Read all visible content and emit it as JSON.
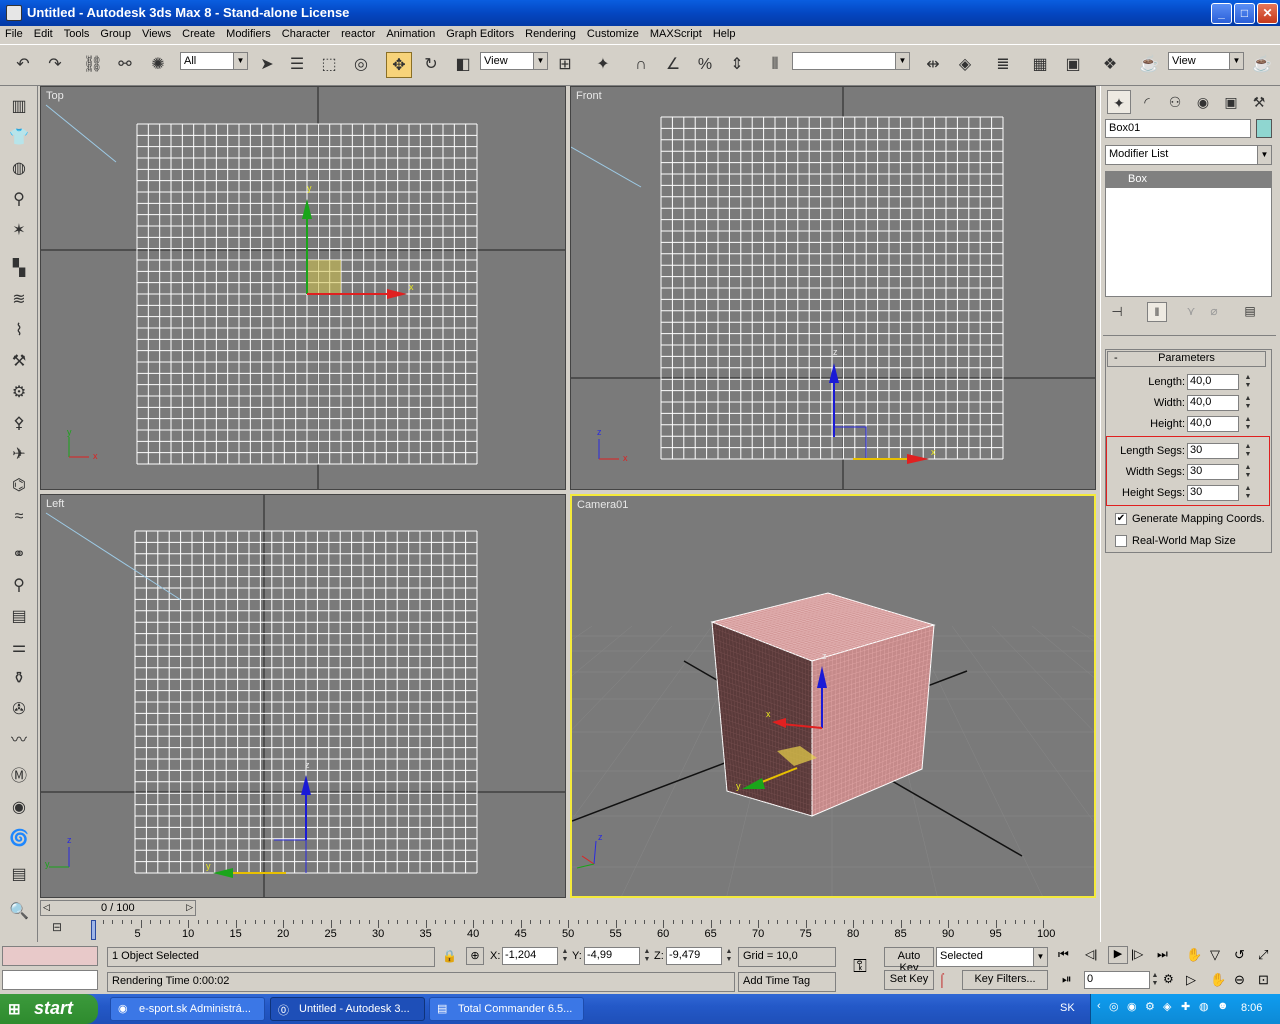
{
  "titlebar": {
    "title": "Untitled - Autodesk 3ds Max 8  - Stand-alone License",
    "min": "_",
    "max": "□",
    "close": "✕"
  },
  "menu": [
    "File",
    "Edit",
    "Tools",
    "Group",
    "Views",
    "Create",
    "Modifiers",
    "Character",
    "reactor",
    "Animation",
    "Graph Editors",
    "Rendering",
    "Customize",
    "MAXScript",
    "Help"
  ],
  "toolbar": {
    "selection_filter": "All",
    "ref_coord": "View",
    "named_sel": "",
    "render_view": "View"
  },
  "viewports": {
    "top": {
      "label": "Top"
    },
    "front": {
      "label": "Front"
    },
    "left": {
      "label": "Left"
    },
    "camera": {
      "label": "Camera01"
    }
  },
  "axes": {
    "x": "x",
    "y": "y",
    "z": "z"
  },
  "command_panel": {
    "object_name": "Box01",
    "modifier_list": "Modifier List",
    "stack_item": "Box",
    "rollout": {
      "collapse": "-",
      "title": "Parameters"
    },
    "params": [
      {
        "label": "Length:",
        "value": "40,0"
      },
      {
        "label": "Width:",
        "value": "40,0"
      },
      {
        "label": "Height:",
        "value": "40,0"
      },
      {
        "label": "Length Segs:",
        "value": "30"
      },
      {
        "label": "Width Segs:",
        "value": "30"
      },
      {
        "label": "Height Segs:",
        "value": "30"
      }
    ],
    "generate_mapping": {
      "label": "Generate Mapping Coords.",
      "checked": true
    },
    "real_world": {
      "label": "Real-World Map Size",
      "checked": false
    }
  },
  "timeline": {
    "frame": "0 / 100",
    "ticks": [
      "0",
      "5",
      "10",
      "15",
      "20",
      "25",
      "30",
      "35",
      "40",
      "45",
      "50",
      "55",
      "60",
      "65",
      "70",
      "75",
      "80",
      "85",
      "90",
      "95",
      "100"
    ]
  },
  "status": {
    "selected": "1 Object Selected",
    "prompt": "Rendering Time  0:00:02",
    "x": "-1,204",
    "y": "-4,99",
    "z": "-9,479",
    "x_label": "X:",
    "y_label": "Y:",
    "z_label": "Z:",
    "grid": "Grid = 10,0",
    "add_time_tag": "Add Time Tag",
    "auto_key": "Auto Key",
    "set_key": "Set Key",
    "key_mode": "Selected",
    "key_filters": "Key Filters...",
    "current_frame": "0"
  },
  "taskbar": {
    "start": "start",
    "tasks": [
      "e-sport.sk Administrá...",
      "Untitled - Autodesk 3...",
      "Total Commander 6.5..."
    ],
    "lang": "SK",
    "clock": "8:06"
  }
}
